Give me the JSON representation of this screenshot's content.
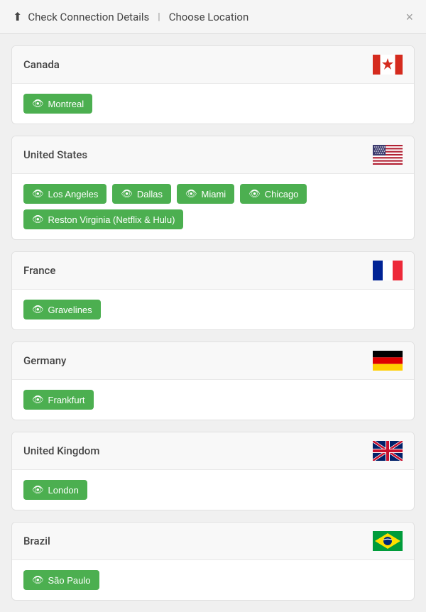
{
  "header": {
    "icon": "⬆",
    "title": "Check Connection Details",
    "separator": "|",
    "subtitle": "Choose Location",
    "close_label": "×"
  },
  "countries": [
    {
      "id": "canada",
      "name": "Canada",
      "locations": [
        "Montreal"
      ]
    },
    {
      "id": "united-states",
      "name": "United States",
      "locations": [
        "Los Angeles",
        "Dallas",
        "Miami",
        "Chicago",
        "Reston Virginia (Netflix &Amp; Hulu)"
      ]
    },
    {
      "id": "france",
      "name": "France",
      "locations": [
        "Gravelines"
      ]
    },
    {
      "id": "germany",
      "name": "Germany",
      "locations": [
        "Frankfurt"
      ]
    },
    {
      "id": "united-kingdom",
      "name": "United Kingdom",
      "locations": [
        "London"
      ]
    },
    {
      "id": "brazil",
      "name": "Brazil",
      "locations": [
        "São Paulo"
      ]
    }
  ]
}
